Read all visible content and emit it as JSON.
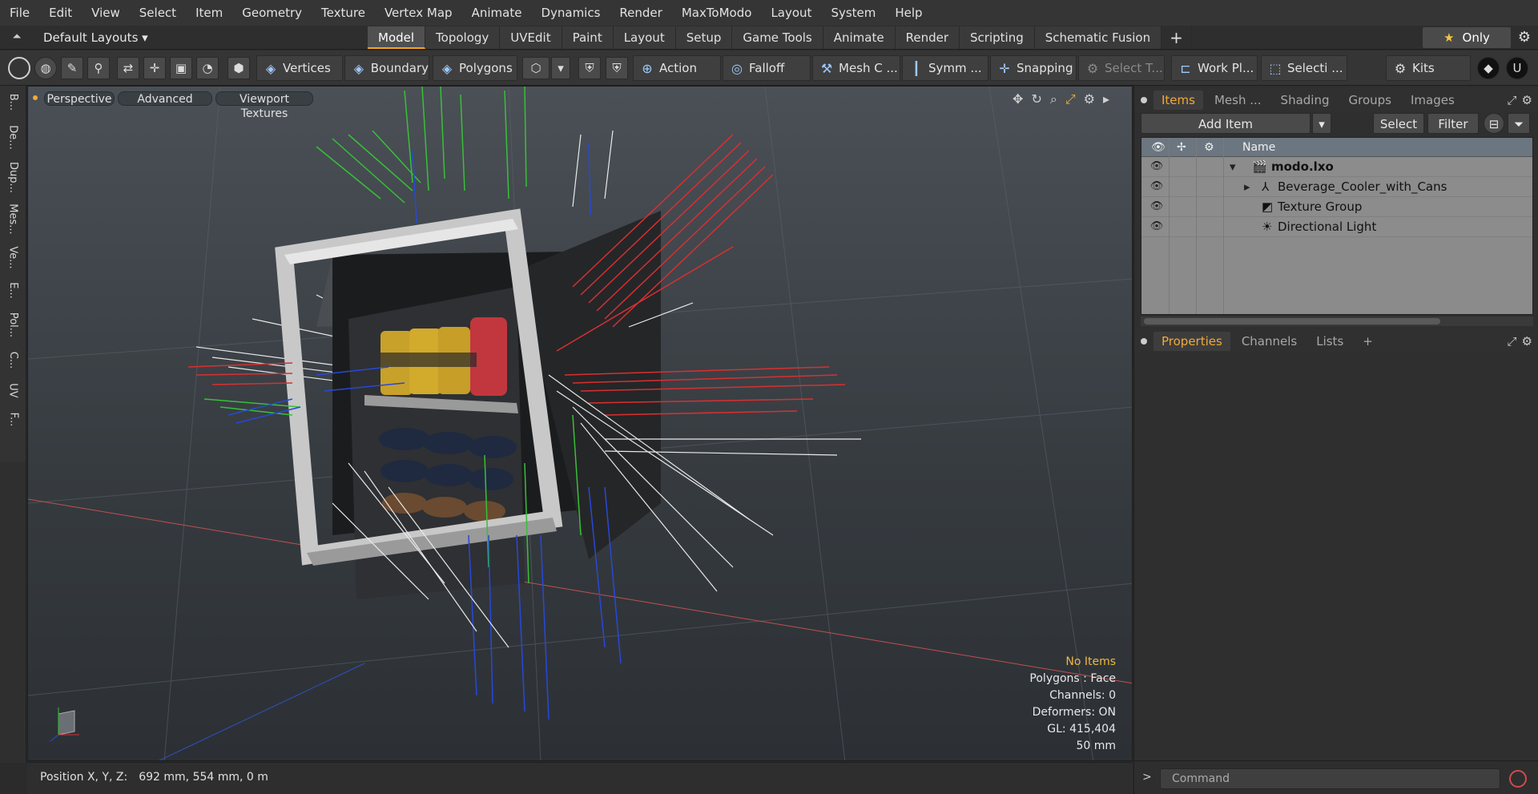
{
  "menu": [
    "File",
    "Edit",
    "View",
    "Select",
    "Item",
    "Geometry",
    "Texture",
    "Vertex Map",
    "Animate",
    "Dynamics",
    "Render",
    "MaxToModo",
    "Layout",
    "System",
    "Help"
  ],
  "layout_selector": "Default Layouts ▾",
  "tabs": [
    "Model",
    "Topology",
    "UVEdit",
    "Paint",
    "Layout",
    "Setup",
    "Game Tools",
    "Animate",
    "Render",
    "Scripting",
    "Schematic Fusion"
  ],
  "active_tab": "Model",
  "only_label": "Only",
  "toolbar": {
    "vertices": "Vertices",
    "boundary": "Boundary",
    "polygons": "Polygons",
    "action": "Action",
    "falloff": "Falloff",
    "mesh_c": "Mesh C ...",
    "symm": "Symm ...",
    "snapping": "Snapping",
    "select_t": "Select T...",
    "work_pl": "Work Pl...",
    "selecti": "Selecti ...",
    "kits": "Kits"
  },
  "left_strip": [
    "B...",
    "De...",
    "Dup...",
    "Mes...",
    "Ve...",
    "E...",
    "Pol...",
    "C...",
    "UV",
    "F..."
  ],
  "viewport": {
    "perspective": "Perspective",
    "advanced": "Advanced",
    "viewport_textures": "Viewport Textures",
    "stats": {
      "no_items": "No Items",
      "polygons": "Polygons : Face",
      "channels": "Channels: 0",
      "deformers": "Deformers: ON",
      "gl": "GL: 415,404",
      "size": "50 mm"
    }
  },
  "status": {
    "label": "Position X, Y, Z:",
    "value": "692 mm, 554 mm, 0 m"
  },
  "items_panel": {
    "tabs": [
      "Items",
      "Mesh ...",
      "Shading",
      "Groups",
      "Images"
    ],
    "active": "Items",
    "add_item": "Add Item",
    "select": "Select",
    "filter": "Filter",
    "header_name": "Name",
    "rows": [
      {
        "label": "modo.lxo",
        "bold": true
      },
      {
        "label": "Beverage_Cooler_with_Cans"
      },
      {
        "label": "Texture Group"
      },
      {
        "label": "Directional Light"
      }
    ]
  },
  "properties_panel": {
    "tabs": [
      "Properties",
      "Channels",
      "Lists"
    ],
    "active": "Properties"
  },
  "command": {
    "placeholder": "Command"
  },
  "colors": {
    "accent": "#f5a623",
    "x_axis": "#e03030",
    "y_axis": "#30c030",
    "z_axis": "#2050e0"
  }
}
